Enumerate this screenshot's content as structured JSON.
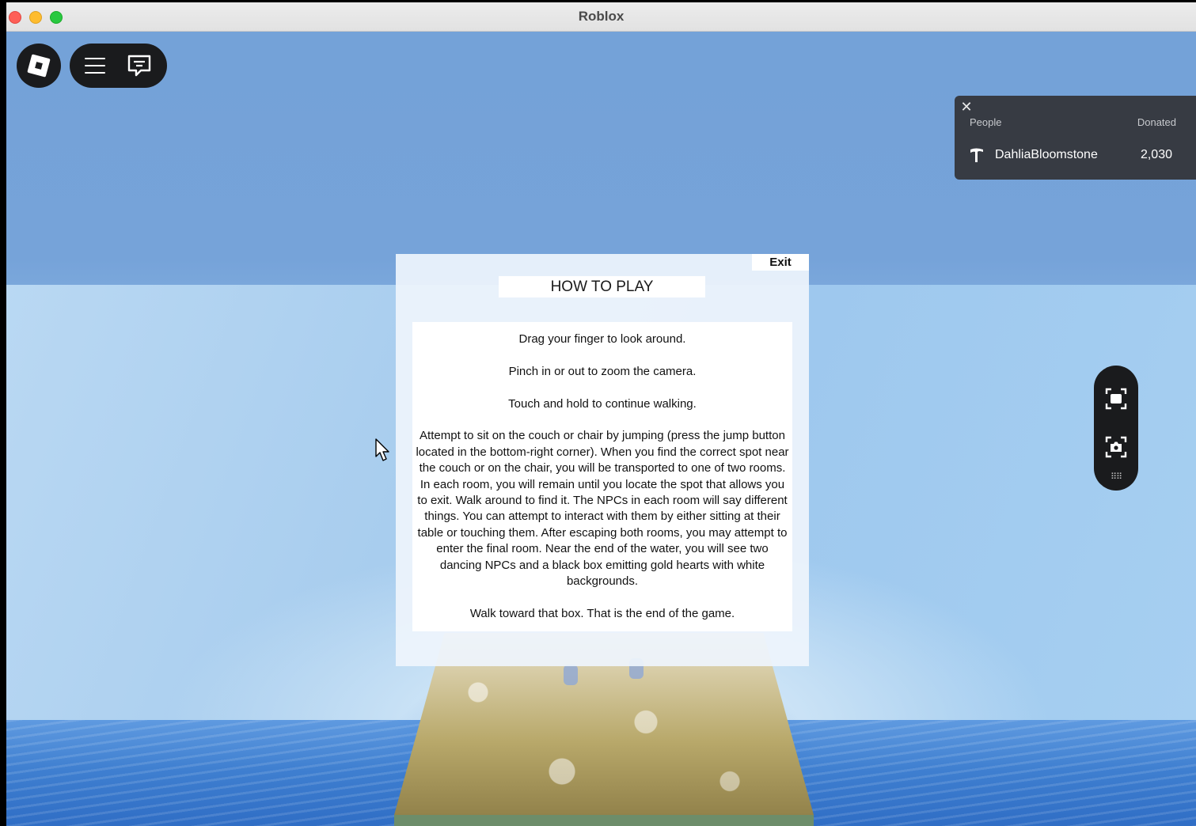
{
  "window": {
    "title": "Roblox"
  },
  "toolbar": {
    "roblox_icon": "roblox-logo-icon",
    "menu_icon": "hamburger-menu-icon",
    "chat_icon": "chat-bubble-icon"
  },
  "donations": {
    "close_icon": "close-icon",
    "close_glyph": "✕",
    "columns": {
      "people": "People",
      "donated": "Donated"
    },
    "rows": [
      {
        "icon": "hammer-tool-icon",
        "name": "DahliaBloomstone",
        "amount": "2,030"
      }
    ]
  },
  "camera_controls": {
    "icons": [
      "camera-capture-icon",
      "screenshot-camera-icon",
      "drag-handle-icon"
    ],
    "drag_glyph": "⠿⠿"
  },
  "dialog": {
    "exit_label": "Exit",
    "title": "HOW TO PLAY",
    "paragraphs": [
      "Drag your finger to look around.",
      "Pinch in or out to zoom the camera.",
      "Touch and hold to continue walking.",
      "Attempt to sit on the couch or chair by jumping (press the jump button located in the bottom-right corner). When you find the correct spot near the couch or on the chair, you will be transported to one of two rooms. In each room, you will remain until you locate the spot that allows you to exit. Walk around to find it. The NPCs in each room will say different things. You can attempt to interact with them by either sitting at their table or touching them. After escaping both rooms, you may attempt to enter the final room. Near the end of the water, you will see two dancing NPCs and a black box emitting gold hearts with white backgrounds.",
      "Walk toward that box. That is the end of the game."
    ]
  },
  "colors": {
    "sky": "#74a2d8",
    "panel_dark": "#1a1b1d",
    "donate_panel": "#373b43"
  }
}
